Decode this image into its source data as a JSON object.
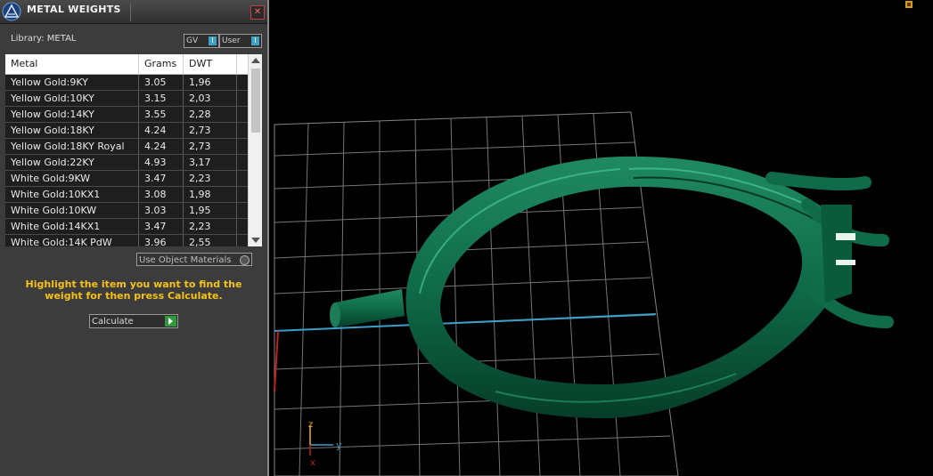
{
  "panel": {
    "title": "METAL WEIGHTS",
    "close": "✕",
    "library_label": "Library: METAL",
    "gv_label": "GV",
    "user_label": "User",
    "table": {
      "headers": [
        "Metal",
        "Grams",
        "DWT"
      ],
      "rows": [
        [
          "Yellow Gold:9KY",
          "3.05",
          "1,96"
        ],
        [
          "Yellow Gold:10KY",
          "3.15",
          "2,03"
        ],
        [
          "Yellow Gold:14KY",
          "3.55",
          "2,28"
        ],
        [
          "Yellow Gold:18KY",
          "4.24",
          "2,73"
        ],
        [
          "Yellow Gold:18KY Royal",
          "4.24",
          "2,73"
        ],
        [
          "Yellow Gold:22KY",
          "4.93",
          "3,17"
        ],
        [
          "White Gold:9KW",
          "3.47",
          "2,23"
        ],
        [
          "White Gold:10KX1",
          "3.08",
          "1,98"
        ],
        [
          "White Gold:10KW",
          "3.03",
          "1,95"
        ],
        [
          "White Gold:14KX1",
          "3.47",
          "2,23"
        ],
        [
          "White Gold:14K PdW",
          "3.96",
          "2,55"
        ]
      ]
    },
    "use_object_materials": "Use Object Materials",
    "hint": "Highlight the item you want to find the weight for then press Calculate.",
    "calculate_label": "Calculate"
  },
  "viewport": {
    "axis_z": "z",
    "axis_y": "y",
    "axis_x": "x",
    "ring_color": "#0f6b4a"
  }
}
